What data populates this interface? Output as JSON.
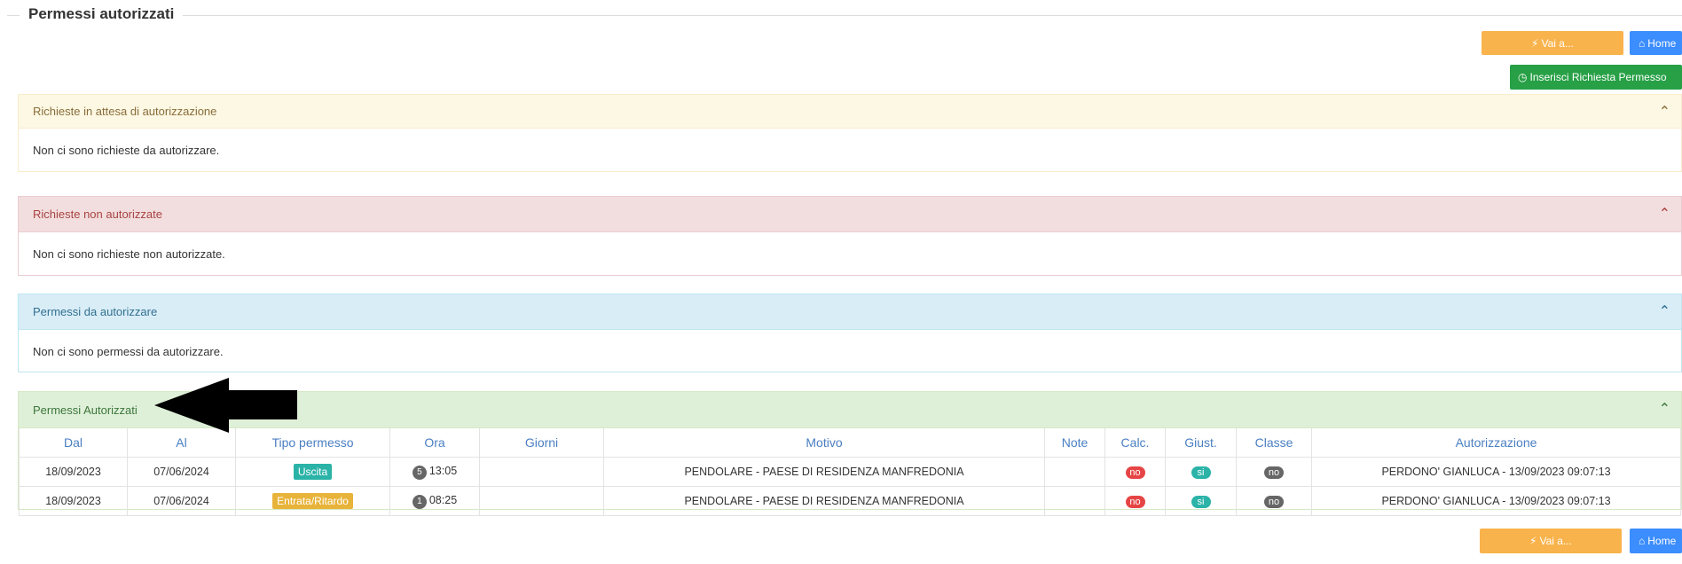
{
  "page": {
    "title": "Permessi autorizzati"
  },
  "toolbar": {
    "vai_label": "Vai a...",
    "home_label": "Home",
    "inserisci_label": "Inserisci Richiesta Permesso"
  },
  "panels": {
    "attesa": {
      "title": "Richieste in attesa di autorizzazione",
      "message": "Non ci sono richieste da autorizzare."
    },
    "non_autorizzate": {
      "title": "Richieste non autorizzate",
      "message": "Non ci sono richieste non autorizzate."
    },
    "da_autorizzare": {
      "title": "Permessi da autorizzare",
      "message": "Non ci sono permessi da autorizzare."
    },
    "autorizzati": {
      "title": "Permessi Autorizzati"
    }
  },
  "table": {
    "headers": [
      "Dal",
      "Al",
      "Tipo permesso",
      "Ora",
      "Giorni",
      "Motivo",
      "Note",
      "Calc.",
      "Giust.",
      "Classe",
      "Autorizzazione"
    ],
    "rows": [
      {
        "dal": "18/09/2023",
        "al": "07/06/2024",
        "tipo": "Uscita",
        "ora_n": "5",
        "ora": "13:05",
        "giorni": "",
        "motivo": "PENDOLARE - PAESE DI RESIDENZA MANFREDONIA",
        "note": "",
        "calc": "no",
        "giust": "si",
        "classe": "no",
        "autorizzazione": "PERDONO' GIANLUCA - 13/09/2023 09:07:13"
      },
      {
        "dal": "18/09/2023",
        "al": "07/06/2024",
        "tipo": "Entrata/Ritardo",
        "ora_n": "1",
        "ora": "08:25",
        "giorni": "",
        "motivo": "PENDOLARE - PAESE DI RESIDENZA MANFREDONIA",
        "note": "",
        "calc": "no",
        "giust": "si",
        "classe": "no",
        "autorizzazione": "PERDONO' GIANLUCA - 13/09/2023 09:07:13"
      }
    ]
  },
  "colors": {
    "orange": "#f9b34c",
    "blue": "#3c8dfd",
    "green": "#27a046"
  },
  "icons": [
    "bolt-icon",
    "home-icon",
    "clock-icon",
    "chevron-up-icon",
    "arrow-annotation"
  ]
}
